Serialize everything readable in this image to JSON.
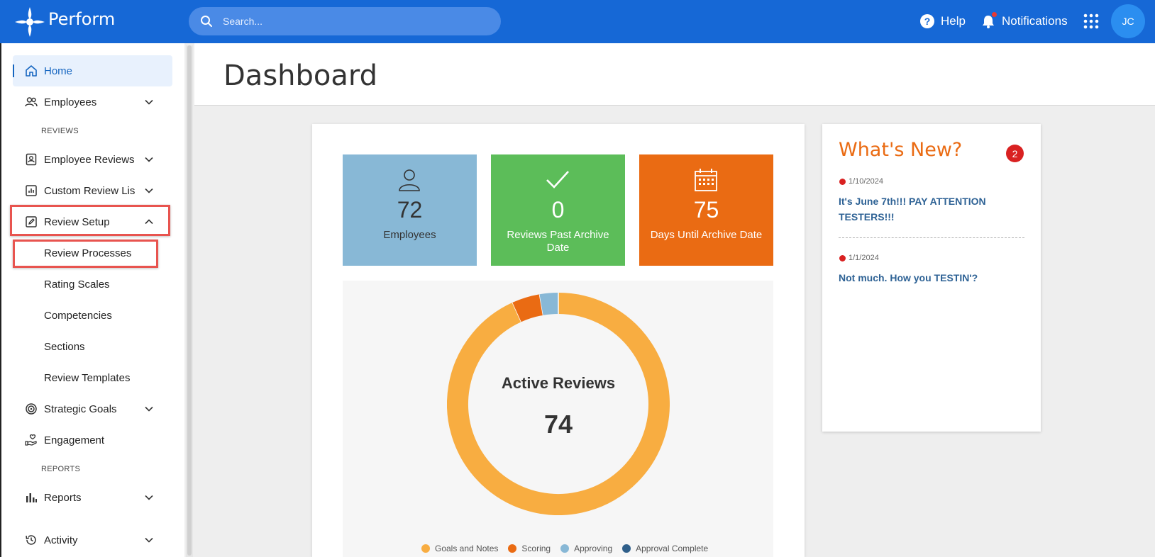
{
  "topbar": {
    "brand": "Perform",
    "search_placeholder": "Search...",
    "help_label": "Help",
    "notifications_label": "Notifications",
    "avatar_initials": "JC"
  },
  "sidebar": {
    "home": "Home",
    "employees": "Employees",
    "section_reviews": "REVIEWS",
    "employee_reviews": "Employee Reviews",
    "custom_review_lists": "Custom Review Lis",
    "review_setup": "Review Setup",
    "review_setup_items": [
      "Review Processes",
      "Rating Scales",
      "Competencies",
      "Sections",
      "Review Templates"
    ],
    "strategic_goals": "Strategic Goals",
    "engagement": "Engagement",
    "section_reports": "REPORTS",
    "reports": "Reports",
    "activity": "Activity"
  },
  "main": {
    "title": "Dashboard",
    "tiles": [
      {
        "value": "72",
        "label": "Employees",
        "color": "#88b8d6"
      },
      {
        "value": "0",
        "label": "Reviews Past Archive Date",
        "color": "#5cbd59"
      },
      {
        "value": "75",
        "label": "Days Until Archive Date",
        "color": "#ea6b13"
      }
    ]
  },
  "chart_data": {
    "type": "pie",
    "title": "Active Reviews",
    "total": "74",
    "categories": [
      "Goals and Notes",
      "Scoring",
      "Approving",
      "Approval Complete"
    ],
    "values": [
      69,
      3,
      2,
      0
    ],
    "colors": [
      "#f8ad41",
      "#ea6b13",
      "#88b8d6",
      "#2f5f8a"
    ],
    "legend_position": "bottom"
  },
  "whats_new": {
    "title": "What's New?",
    "badge": "2",
    "items": [
      {
        "date": "1/10/2024",
        "headline": "It's June 7th!!! PAY ATTENTION TESTERS!!!"
      },
      {
        "date": "1/1/2024",
        "headline": "Not much. How you TESTIN'?"
      }
    ]
  },
  "icons": [
    "perform-logo-icon",
    "search-icon",
    "help-icon",
    "bell-icon",
    "apps-grid-icon",
    "home-icon",
    "users-icon",
    "id-badge-icon",
    "list-chart-icon",
    "edit-square-icon",
    "target-icon",
    "hand-heart-icon",
    "bar-chart-icon",
    "history-icon",
    "chevron-down-icon",
    "chevron-up-icon",
    "person-icon",
    "check-icon",
    "calendar-icon"
  ]
}
